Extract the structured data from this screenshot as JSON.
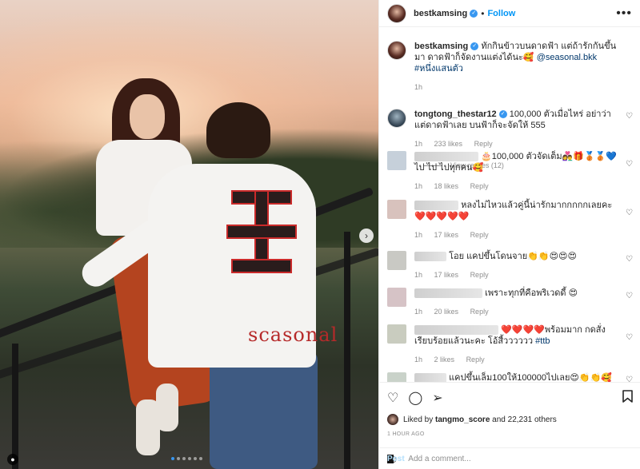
{
  "post": {
    "author": "bestkamsing",
    "follow_label": "Follow",
    "more_label": "•••",
    "caption_text": "ทักกินข้าวบนดาดฟ้า แต่ถ้ารักกันขึ้นมา ดาดฟ้าก็จัดงานแต่งได้นะ🥰",
    "caption_mention": "@seasonal.bkk",
    "caption_hashtag": "#หนึ่งแสนตัว",
    "caption_time": "1h",
    "shirt_brand": "scasonal"
  },
  "comments": [
    {
      "user": "tongtong_thestar12",
      "text": "100,000 ตัวเมื่อไหร่ อย่าว่าแต่ดาดฟ้าเลย บนฟ้าก็จะจัดให้ 555",
      "time": "1h",
      "likes": "233 likes",
      "reply": "Reply",
      "view_replies": "View replies (12)"
    },
    {
      "text": "🎂100,000 ตัวจัดเต็ม👩‍❤️‍👨🎁🥉🥉💙 ไป ไป ไปทุกคน🥰",
      "time": "1h",
      "likes": "18 likes",
      "reply": "Reply"
    },
    {
      "text": "หลงไม่ไหวแล้วคู่นี้น่ารักมากกกกกเลยคะ❤️❤️❤️❤️❤️",
      "time": "1h",
      "likes": "17 likes",
      "reply": "Reply"
    },
    {
      "text": "โอย แคปขึ้นโดนจาย👏👏😍😍😍",
      "time": "1h",
      "likes": "17 likes",
      "reply": "Reply"
    },
    {
      "text": "เพราะทุกที่คือพริเวดดี้ 😍",
      "time": "1h",
      "likes": "20 likes",
      "reply": "Reply"
    },
    {
      "text": "❤️❤️❤️❤️พร้อมมาก กดสั่งเรียบร้อยแล้วนะคะ โอ้สี้วววววว",
      "hashtag": "#ttb",
      "time": "1h",
      "likes": "2 likes",
      "reply": "Reply"
    },
    {
      "text": "แคปขึ้นเล็ม100ให้100000ไปเลย😍👏👏🥰",
      "time": "",
      "likes": "",
      "reply": ""
    }
  ],
  "likes_line": {
    "prefix": "Liked by",
    "user": "tangmo_score",
    "suffix": "and 22,231 others"
  },
  "posted_ago": "1 HOUR AGO",
  "comment_box": {
    "placeholder": "Add a comment...",
    "post_label": "Post"
  },
  "icons": {
    "like": "heart-icon",
    "comment": "comment-icon",
    "share": "paper-plane-icon",
    "save": "bookmark-icon",
    "emoji": "smile-icon"
  },
  "colors": {
    "accent": "#0095f6",
    "verified": "#3897f0",
    "brand_red": "#b62a2a"
  }
}
